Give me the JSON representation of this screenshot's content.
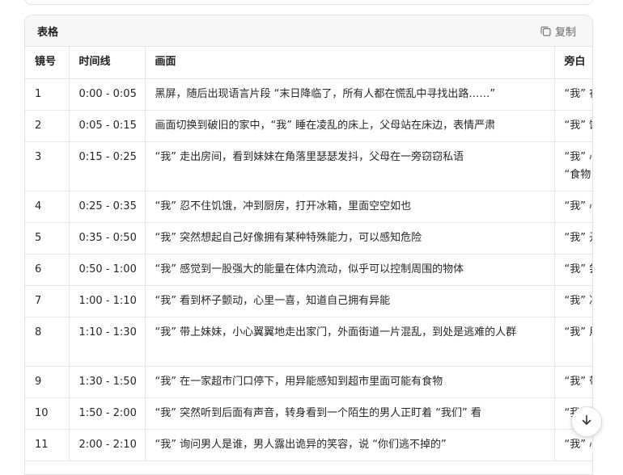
{
  "card": {
    "title": "表格",
    "copy_label": "复制",
    "copy_icon": "copy-icon"
  },
  "table": {
    "headers": [
      "镜号",
      "时间线",
      "画面",
      "旁白"
    ],
    "rows": [
      {
        "no": "1",
        "time": "0:00 - 0:05",
        "scene": "黑屏，随后出现语言片段 “末日降临了，所有人都在慌乱中寻找出路……”",
        "narration": "“我” 在"
      },
      {
        "no": "2",
        "time": "0:05 - 0:15",
        "scene": "画面切换到破旧的家中，“我” 睡在凌乱的床上，父母站在床边，表情严肃",
        "narration": "“我” 饿"
      },
      {
        "no": "3",
        "time": "0:15 - 0:25",
        "scene": "“我” 走出房间，看到妹妹在角落里瑟瑟发抖，父母在一旁窃窃私语",
        "narration": "“我” 心\n“食物"
      },
      {
        "no": "4",
        "time": "0:25 - 0:35",
        "scene": "“我” 忍不住饥饿，冲到厨房，打开冰箱，里面空空如也",
        "narration": "“我” 心"
      },
      {
        "no": "5",
        "time": "0:35 - 0:50",
        "scene": "“我” 突然想起自己好像拥有某种特殊能力，可以感知危险",
        "narration": "“我” 开"
      },
      {
        "no": "6",
        "time": "0:50 - 1:00",
        "scene": "“我” 感觉到一股强大的能量在体内流动，似乎可以控制周围的物体",
        "narration": "“我” 尝"
      },
      {
        "no": "7",
        "time": "1:00 - 1:10",
        "scene": "“我” 看到杯子颤动，心里一喜，知道自己拥有异能",
        "narration": "“我” 决"
      },
      {
        "no": "8",
        "time": "1:10 - 1:30",
        "scene": "“我” 带上妹妹，小心翼翼地走出家门，外面街道一片混乱，到处是逃难的人群",
        "narration": "“我” 用"
      },
      {
        "no": "9",
        "time": "1:30 - 1:50",
        "scene": "“我” 在一家超市门口停下，用异能感知到超市里面可能有食物",
        "narration": "“我” 带"
      },
      {
        "no": "10",
        "time": "1:50 - 2:00",
        "scene": "“我” 突然听到后面有声音，转身看到一个陌生的男人正盯着 “我们” 看",
        "narration": "“我” 警"
      },
      {
        "no": "11",
        "time": "2:00 - 2:10",
        "scene": "“我” 询问男人是谁，男人露出诡异的笑容，说 “你们逃不掉的”",
        "narration": "“我” 心"
      }
    ]
  },
  "scroll_button": {
    "icon": "arrow-down-icon"
  }
}
